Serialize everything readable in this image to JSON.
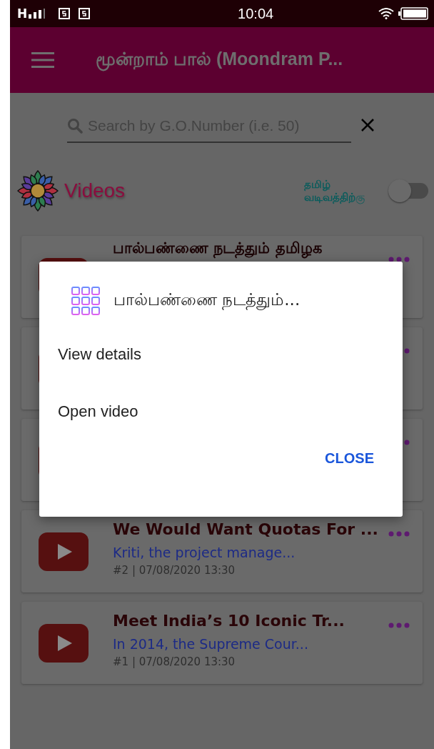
{
  "status_bar": {
    "network": "H",
    "time": "10:04"
  },
  "app_bar": {
    "title": "மூன்றாம் பால் (Moondram P..."
  },
  "search": {
    "placeholder": "Search by G.O.Number (i.e. 50)"
  },
  "section": {
    "title": "Videos",
    "toggle_label": "தமிழ் வடிவத்திற்கு",
    "toggle_on": false
  },
  "videos": [
    {
      "kind": "partial",
      "title": "பால்பண்ணை நடத்தும் தமிழக"
    },
    {
      "kind": "covered"
    },
    {
      "kind": "covered"
    },
    {
      "kind": "full",
      "title": "We Would Want Quotas For ...",
      "summary": "Kriti, the project manage...",
      "meta": "#2 | 07/08/2020 13:30"
    },
    {
      "kind": "full",
      "title": "Meet India’s 10 Iconic Tr...",
      "summary": "In 2014, the Supreme Cour...",
      "meta": "#1 | 07/08/2020 13:30"
    }
  ],
  "dialog": {
    "title": "பால்பண்ணை நடத்தும்...",
    "options": [
      "View details",
      "Open video"
    ],
    "close": "CLOSE"
  }
}
